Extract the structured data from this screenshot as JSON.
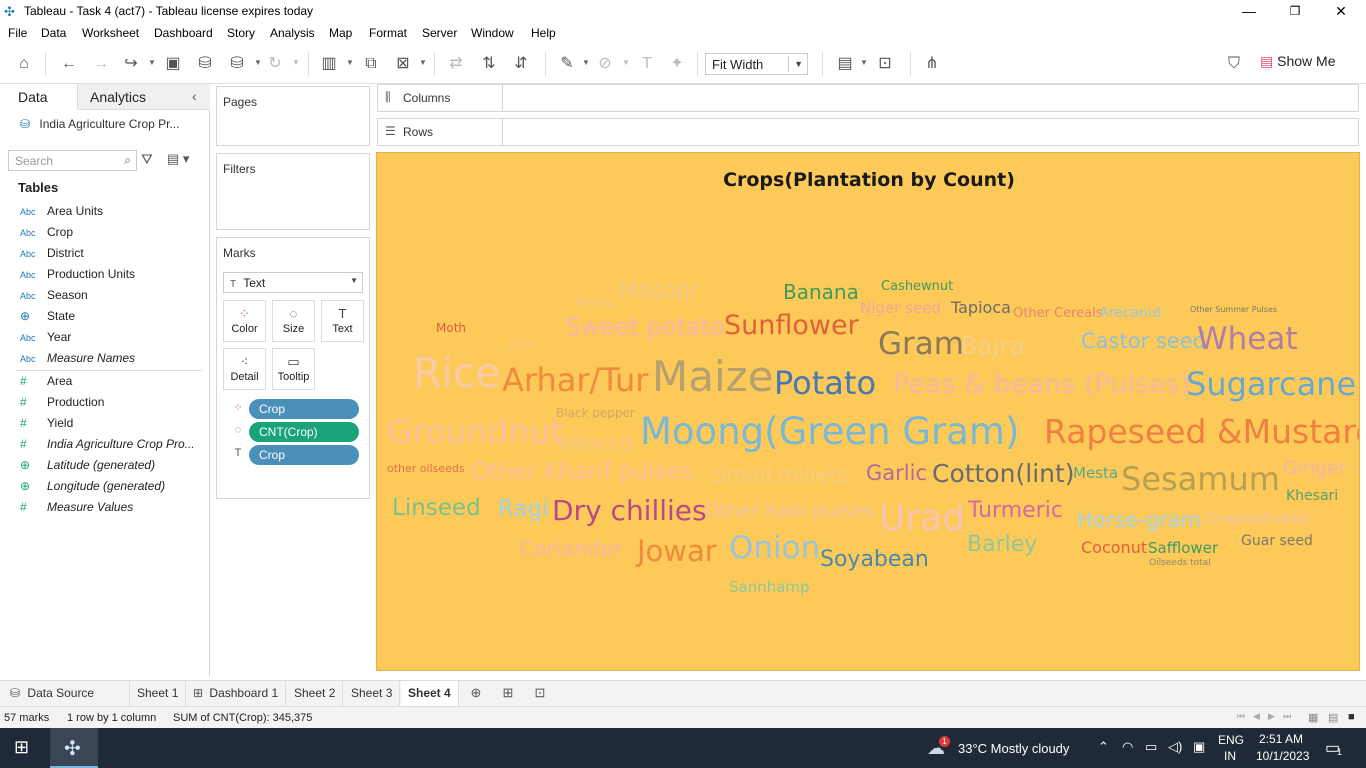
{
  "window": {
    "title": "Tableau - Task 4 (act7) - Tableau license expires today",
    "minimize": "—",
    "restore": "❐",
    "close": "✕"
  },
  "menu": [
    "File",
    "Data",
    "Worksheet",
    "Dashboard",
    "Story",
    "Analysis",
    "Map",
    "Format",
    "Server",
    "Window",
    "Help"
  ],
  "toolbar": {
    "fit_label": "Fit Width",
    "show_me_label": "Show Me"
  },
  "data_pane": {
    "tab_data": "Data",
    "tab_analytics": "Analytics",
    "datasource": "India Agriculture Crop Pr...",
    "search_placeholder": "Search",
    "tables_header": "Tables",
    "dimensions": [
      {
        "type": "Abc",
        "label": "Area Units"
      },
      {
        "type": "Abc",
        "label": "Crop"
      },
      {
        "type": "Abc",
        "label": "District"
      },
      {
        "type": "Abc",
        "label": "Production Units"
      },
      {
        "type": "Abc",
        "label": "Season"
      },
      {
        "type": "globe",
        "label": "State"
      },
      {
        "type": "Abc",
        "label": "Year"
      },
      {
        "type": "Abc",
        "label": "Measure Names"
      }
    ],
    "measures": [
      {
        "type": "#",
        "label": "Area"
      },
      {
        "type": "#",
        "label": "Production"
      },
      {
        "type": "#",
        "label": "Yield"
      },
      {
        "type": "#",
        "label": "India Agriculture Crop Pro..."
      },
      {
        "type": "globe",
        "label": "Latitude (generated)"
      },
      {
        "type": "globe",
        "label": "Longitude (generated)"
      },
      {
        "type": "#",
        "label": "Measure Values"
      }
    ]
  },
  "pages_label": "Pages",
  "filters_label": "Filters",
  "marks": {
    "title": "Marks",
    "mark_type": "Text",
    "buttons": [
      "Color",
      "Size",
      "Text",
      "Detail",
      "Tooltip"
    ],
    "pills": [
      {
        "label": "Crop",
        "color": "#4a90b8"
      },
      {
        "label": "CNT(Crop)",
        "color": "#1aa37a"
      },
      {
        "label": "Crop",
        "color": "#4a90b8"
      }
    ]
  },
  "shelves": {
    "columns": "Columns",
    "rows": "Rows"
  },
  "viz": {
    "title": "Crops(Plantation by Count)",
    "background": "#fdca5a",
    "words": [
      {
        "text": "Cashewnut",
        "color": "#3f9a5c",
        "size": 13
      },
      {
        "text": "Banana",
        "color": "#3f9a5c",
        "size": 20
      },
      {
        "text": "Niger seed",
        "color": "#f4a39a",
        "size": 15
      },
      {
        "text": "Tapioca",
        "color": "#6b6b6b",
        "size": 16
      },
      {
        "text": "Other Cereals",
        "color": "#e8846f",
        "size": 13
      },
      {
        "text": "Arecanut",
        "color": "#9ac7d9",
        "size": 14
      },
      {
        "text": "Other Summer Pulses",
        "color": "#7a7a6a",
        "size": 8
      },
      {
        "text": "Moth",
        "color": "#e05a3f",
        "size": 12
      },
      {
        "text": "Sweet potato",
        "color": "#f5b7a8",
        "size": 24
      },
      {
        "text": "Sunflower",
        "color": "#e0603a",
        "size": 27
      },
      {
        "text": "Gram",
        "color": "#8a7a5a",
        "size": 31
      },
      {
        "text": "Bajra",
        "color": "#f5d08a",
        "size": 25
      },
      {
        "text": "Castor seed",
        "color": "#8fbfd6",
        "size": 21
      },
      {
        "text": "Wheat",
        "color": "#b07ea3",
        "size": 31
      },
      {
        "text": "Rice",
        "color": "#f9c9a8",
        "size": 41
      },
      {
        "text": "Arhar/Tur",
        "color": "#f08a3c",
        "size": 32
      },
      {
        "text": "Maize",
        "color": "#b5a070",
        "size": 42
      },
      {
        "text": "Potato",
        "color": "#4a78b0",
        "size": 32
      },
      {
        "text": "Peas & beans (Pulses)",
        "color": "#f5b8a0",
        "size": 27
      },
      {
        "text": "Sugarcane",
        "color": "#6aa9c9",
        "size": 32
      },
      {
        "text": "Black pepper",
        "color": "#d4a860",
        "size": 12
      },
      {
        "text": "Groundnut",
        "color": "#f5c09a",
        "size": 33
      },
      {
        "text": "Tobacco",
        "color": "#f5c88a",
        "size": 19
      },
      {
        "text": "Moong(Green Gram)",
        "color": "#7ab8d4",
        "size": 37
      },
      {
        "text": "Rapeseed &Mustard",
        "color": "#f08040",
        "size": 33
      },
      {
        "text": "other oilseeds",
        "color": "#e0704a",
        "size": 11
      },
      {
        "text": "Other Kharif pulses",
        "color": "#fbbf9a",
        "size": 23
      },
      {
        "text": "Small millets",
        "color": "#f5cc82",
        "size": 21
      },
      {
        "text": "Garlic",
        "color": "#b06a9a",
        "size": 21
      },
      {
        "text": "Cotton(lint)",
        "color": "#6a6a6a",
        "size": 25
      },
      {
        "text": "Mesta",
        "color": "#5aa88a",
        "size": 15
      },
      {
        "text": "Sesamum",
        "color": "#b8a050",
        "size": 32
      },
      {
        "text": "Ginger",
        "color": "#f5b4a0",
        "size": 19
      },
      {
        "text": "Khesari",
        "color": "#5aa06a",
        "size": 14
      },
      {
        "text": "Linseed",
        "color": "#7ac28a",
        "size": 23
      },
      {
        "text": "Ragi",
        "color": "#a6cfe0",
        "size": 23
      },
      {
        "text": "Dry chillies",
        "color": "#b84a8a",
        "size": 28
      },
      {
        "text": "Other Rabi pulses",
        "color": "#f0c0a0",
        "size": 19
      },
      {
        "text": "Urad",
        "color": "#f9c4b4",
        "size": 36
      },
      {
        "text": "Turmeric",
        "color": "#d46aa0",
        "size": 22
      },
      {
        "text": "Horse-gram",
        "color": "#a9d2e2",
        "size": 21
      },
      {
        "text": "Cowpea(Lobia)",
        "color": "#f0c4a8",
        "size": 14
      },
      {
        "text": "Coriander",
        "color": "#f5b8a0",
        "size": 21
      },
      {
        "text": "Jowar",
        "color": "#f08a3c",
        "size": 29
      },
      {
        "text": "Onion",
        "color": "#9ac4d9",
        "size": 31
      },
      {
        "text": "Soyabean",
        "color": "#4a88a8",
        "size": 22
      },
      {
        "text": "Barley",
        "color": "#8ec89a",
        "size": 22
      },
      {
        "text": "Coconut",
        "color": "#e0603a",
        "size": 16
      },
      {
        "text": "Safflower",
        "color": "#3f9a5c",
        "size": 15
      },
      {
        "text": "Guar seed",
        "color": "#7a7a6a",
        "size": 14
      },
      {
        "text": "Oilseeds total",
        "color": "#8a8a6a",
        "size": 9
      },
      {
        "text": "Sannhamp",
        "color": "#8ec89a",
        "size": 15
      },
      {
        "text": "Moong",
        "color": "#f5c88a",
        "size": 11
      },
      {
        "text": "Masoor",
        "color": "#f5c88a",
        "size": 22
      },
      {
        "text": "Jute",
        "color": "#f5c88a",
        "size": 13
      }
    ]
  },
  "sheet_tabs": {
    "data_source": "Data Source",
    "tabs": [
      "Sheet 1",
      "Dashboard 1",
      "Sheet 2",
      "Sheet 3",
      "Sheet 4"
    ],
    "active": "Sheet 4"
  },
  "status": {
    "marks": "57 marks",
    "layout": "1 row by 1 column",
    "sum": "SUM of CNT(Crop): 345,375"
  },
  "taskbar": {
    "weather": "33°C  Mostly cloudy",
    "lang1": "ENG",
    "lang2": "IN",
    "time": "2:51 AM",
    "date": "10/1/2023",
    "notif_badge": "1",
    "weather_badge": "1"
  }
}
